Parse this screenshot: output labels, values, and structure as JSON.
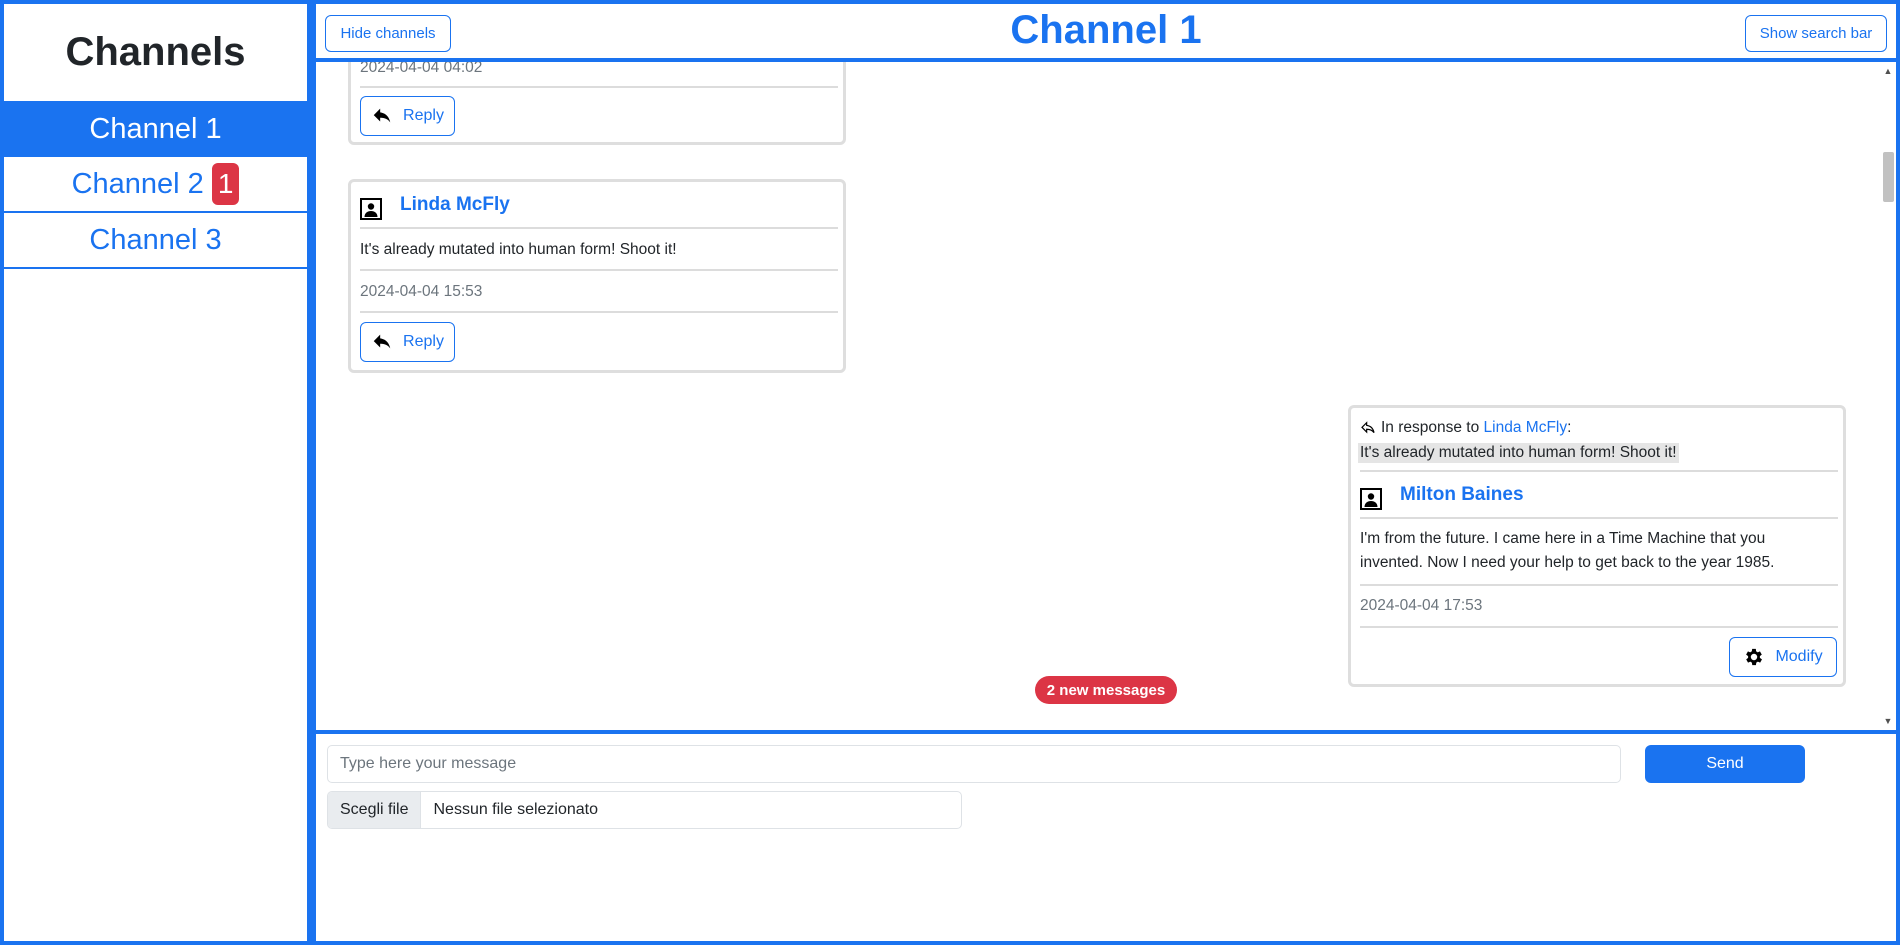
{
  "sidebar": {
    "title": "Channels",
    "channels": [
      {
        "label": "Channel 1",
        "active": true
      },
      {
        "label": "Channel 2",
        "badge": "1"
      },
      {
        "label": "Channel 3"
      }
    ]
  },
  "header": {
    "hide_label": "Hide channels",
    "title": "Channel 1",
    "search_label": "Show search bar"
  },
  "messages": {
    "partial_date": "2024-04-04 04:02",
    "reply_label": "Reply",
    "msg2": {
      "author": "Linda McFly",
      "text": "It's already mutated into human form! Shoot it!",
      "date": "2024-04-04 15:53",
      "reply_label": "Reply"
    },
    "msg3": {
      "in_response_prefix": "In response to",
      "in_response_author": "Linda McFly",
      "in_response_suffix": ":",
      "quote": "It's already mutated into human form! Shoot it!",
      "author": "Milton Baines",
      "text_line1": "I'm from the future. I came here in a Time Machine that you",
      "text_line2": "invented. Now I need your help to get back to the year 1985.",
      "date": "2024-04-04 17:53",
      "modify_label": "Modify"
    },
    "new_messages": "2 new messages"
  },
  "composer": {
    "placeholder": "Type here your message",
    "send_label": "Send",
    "file_choose": "Scegli file",
    "file_none": "Nessun file selezionato"
  },
  "colors": {
    "accent": "#1a73f0",
    "danger": "#dc3545"
  }
}
